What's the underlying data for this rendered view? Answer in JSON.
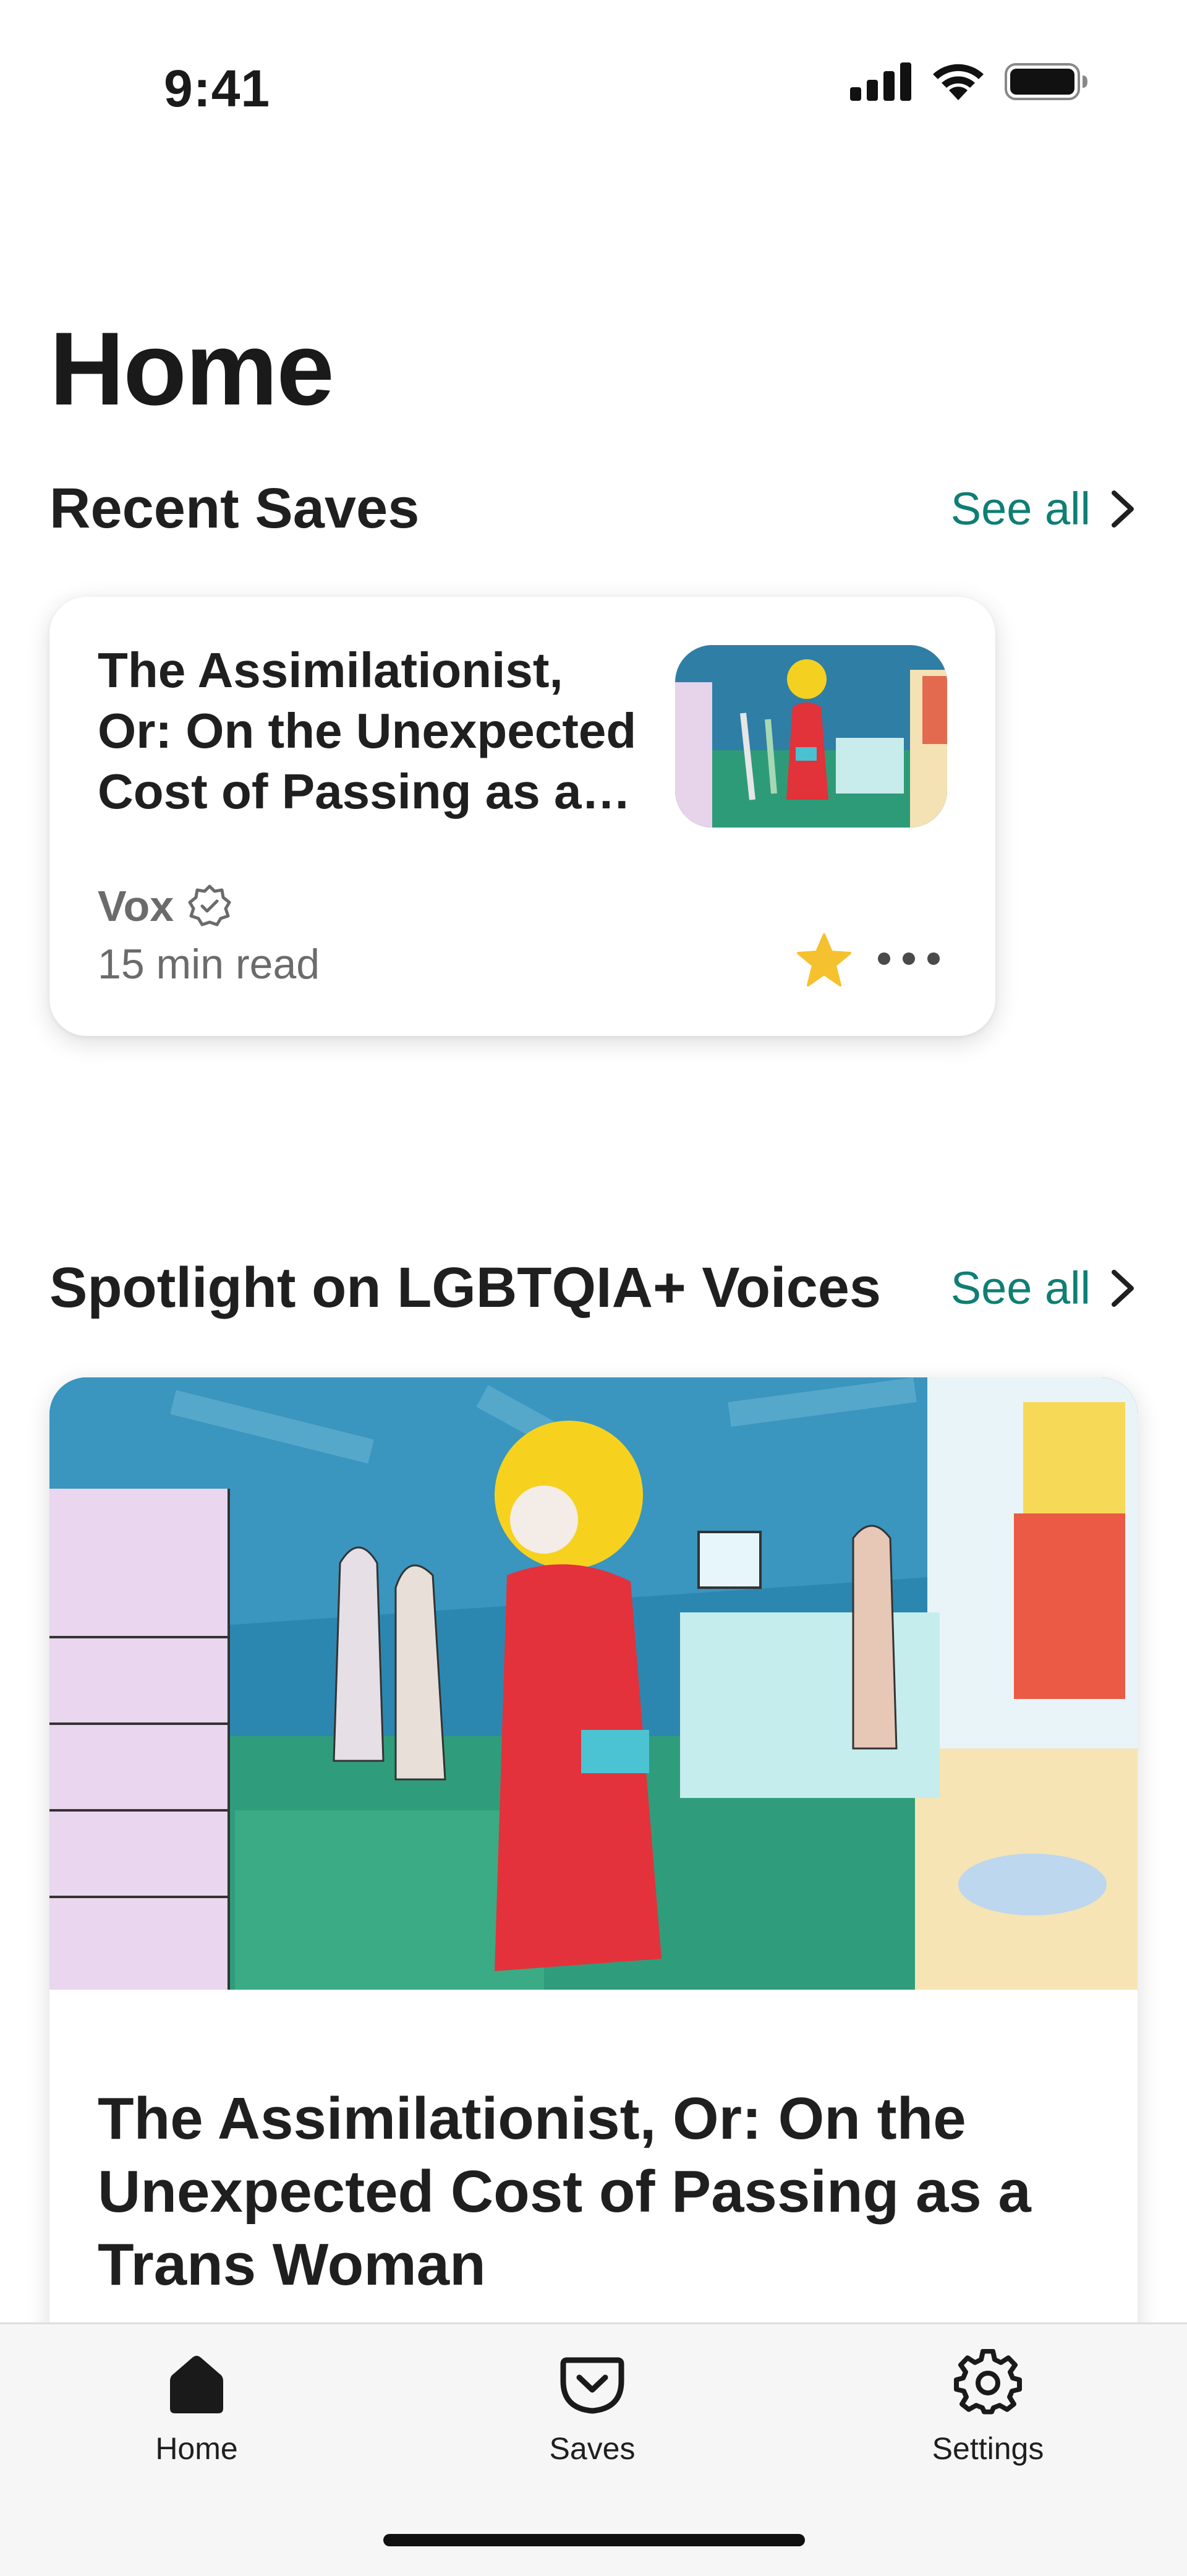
{
  "status_bar": {
    "time": "9:41"
  },
  "page": {
    "title": "Home"
  },
  "recent_saves": {
    "heading": "Recent Saves",
    "see_all": "See all",
    "card": {
      "title": "The Assimilationist, Or: On the Unexpected Cost of Passing as a Trans Woman",
      "source": "Vox",
      "read_time": "15 min read",
      "favorited": true
    }
  },
  "spotlight": {
    "heading": "Spotlight on LGBTQIA+ Voices",
    "see_all": "See all",
    "card": {
      "headline": "The Assimilationist, Or: On the Unexpected Cost of Passing as a Trans Woman"
    }
  },
  "tab_bar": {
    "tabs": [
      {
        "label": "Home",
        "icon": "home-icon",
        "active": true
      },
      {
        "label": "Saves",
        "icon": "pocket-icon",
        "active": false
      },
      {
        "label": "Settings",
        "icon": "gear-icon",
        "active": false
      }
    ]
  },
  "colors": {
    "accent": "#0f7e74",
    "star": "#f5c12e",
    "text": "#1f1f1f",
    "muted": "#6b6b6b"
  }
}
